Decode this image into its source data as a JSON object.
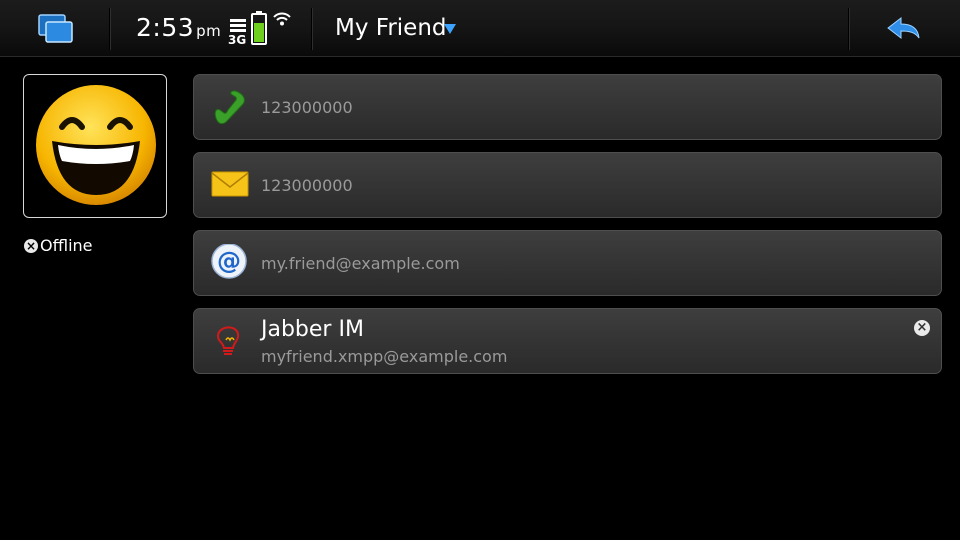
{
  "statusbar": {
    "time": "2:53",
    "ampm": "pm",
    "network": "3G",
    "icons": [
      "task-switcher-icon",
      "network-signal-icon",
      "battery-icon",
      "wifi-icon",
      "back-arrow-icon"
    ]
  },
  "header": {
    "title": "My Friend"
  },
  "contact": {
    "avatar": "smiley-avatar",
    "status": "Offline"
  },
  "fields": {
    "phone": {
      "icon": "phone-handset-icon",
      "value": "123000000"
    },
    "sms": {
      "icon": "envelope-icon",
      "value": "123000000"
    },
    "email": {
      "icon": "at-sign-icon",
      "value": "my.friend@example.com"
    },
    "im": {
      "icon": "jabber-bulb-icon",
      "title": "Jabber IM",
      "value": "myfriend.xmpp@example.com",
      "presence": "offline"
    }
  },
  "colors": {
    "accent": "#3ea3ff",
    "card": "#363636",
    "secondary_text": "#9a9a9a",
    "background": "#000000"
  }
}
